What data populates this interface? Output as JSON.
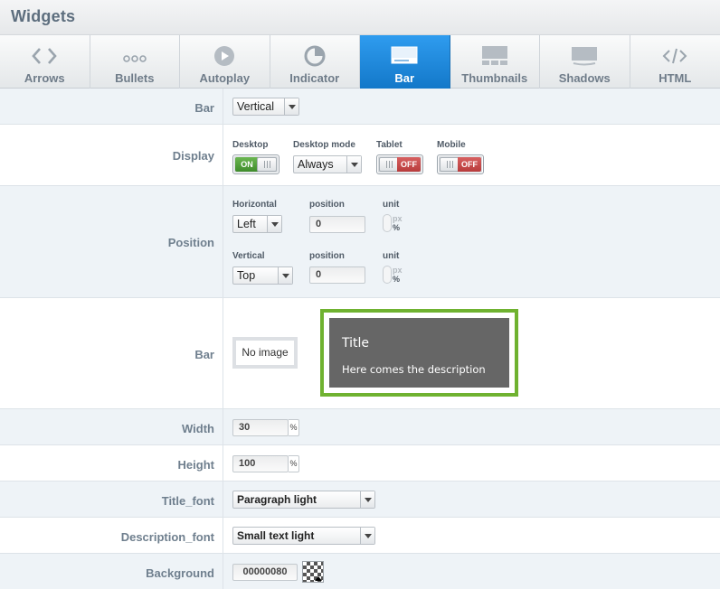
{
  "header": {
    "title": "Widgets"
  },
  "tabs": [
    {
      "label": "Arrows",
      "icon": "arrows-icon",
      "active": false
    },
    {
      "label": "Bullets",
      "icon": "bullets-icon",
      "active": false
    },
    {
      "label": "Autoplay",
      "icon": "play-icon",
      "active": false
    },
    {
      "label": "Indicator",
      "icon": "indicator-icon",
      "active": false
    },
    {
      "label": "Bar",
      "icon": "bar-icon",
      "active": true
    },
    {
      "label": "Thumbnails",
      "icon": "thumbnails-icon",
      "active": false
    },
    {
      "label": "Shadows",
      "icon": "shadows-icon",
      "active": false
    },
    {
      "label": "HTML",
      "icon": "html-icon",
      "active": false
    }
  ],
  "bar_row": {
    "label": "Bar",
    "value": "Vertical"
  },
  "display": {
    "label": "Display",
    "desktop_label": "Desktop",
    "desktop_value": "ON",
    "desktop_mode_label": "Desktop mode",
    "desktop_mode_value": "Always",
    "tablet_label": "Tablet",
    "tablet_value": "OFF",
    "mobile_label": "Mobile",
    "mobile_value": "OFF"
  },
  "position": {
    "label": "Position",
    "horizontal_label": "Horizontal",
    "horizontal_value": "Left",
    "h_position_label": "position",
    "h_position_value": "0",
    "h_unit_label": "unit",
    "vertical_label": "Vertical",
    "vertical_value": "Top",
    "v_position_label": "position",
    "v_position_value": "0",
    "v_unit_label": "unit",
    "unit_px": "px",
    "unit_pct": "%"
  },
  "bar_image": {
    "label": "Bar",
    "no_image": "No image",
    "preview_title": "Title",
    "preview_description": "Here comes the description"
  },
  "width": {
    "label": "Width",
    "value": "30",
    "unit": "%"
  },
  "height": {
    "label": "Height",
    "value": "100",
    "unit": "%"
  },
  "title_font": {
    "label": "Title_font",
    "value": "Paragraph light"
  },
  "description_font": {
    "label": "Description_font",
    "value": "Small text light"
  },
  "background": {
    "label": "Background",
    "value": "00000080"
  },
  "colors": {
    "active_tab": "#1a86dc",
    "label_text": "#6f7f8e",
    "preview_border": "#6fb230",
    "toggle_on": "#4f9e38",
    "toggle_off": "#c44a4a"
  }
}
